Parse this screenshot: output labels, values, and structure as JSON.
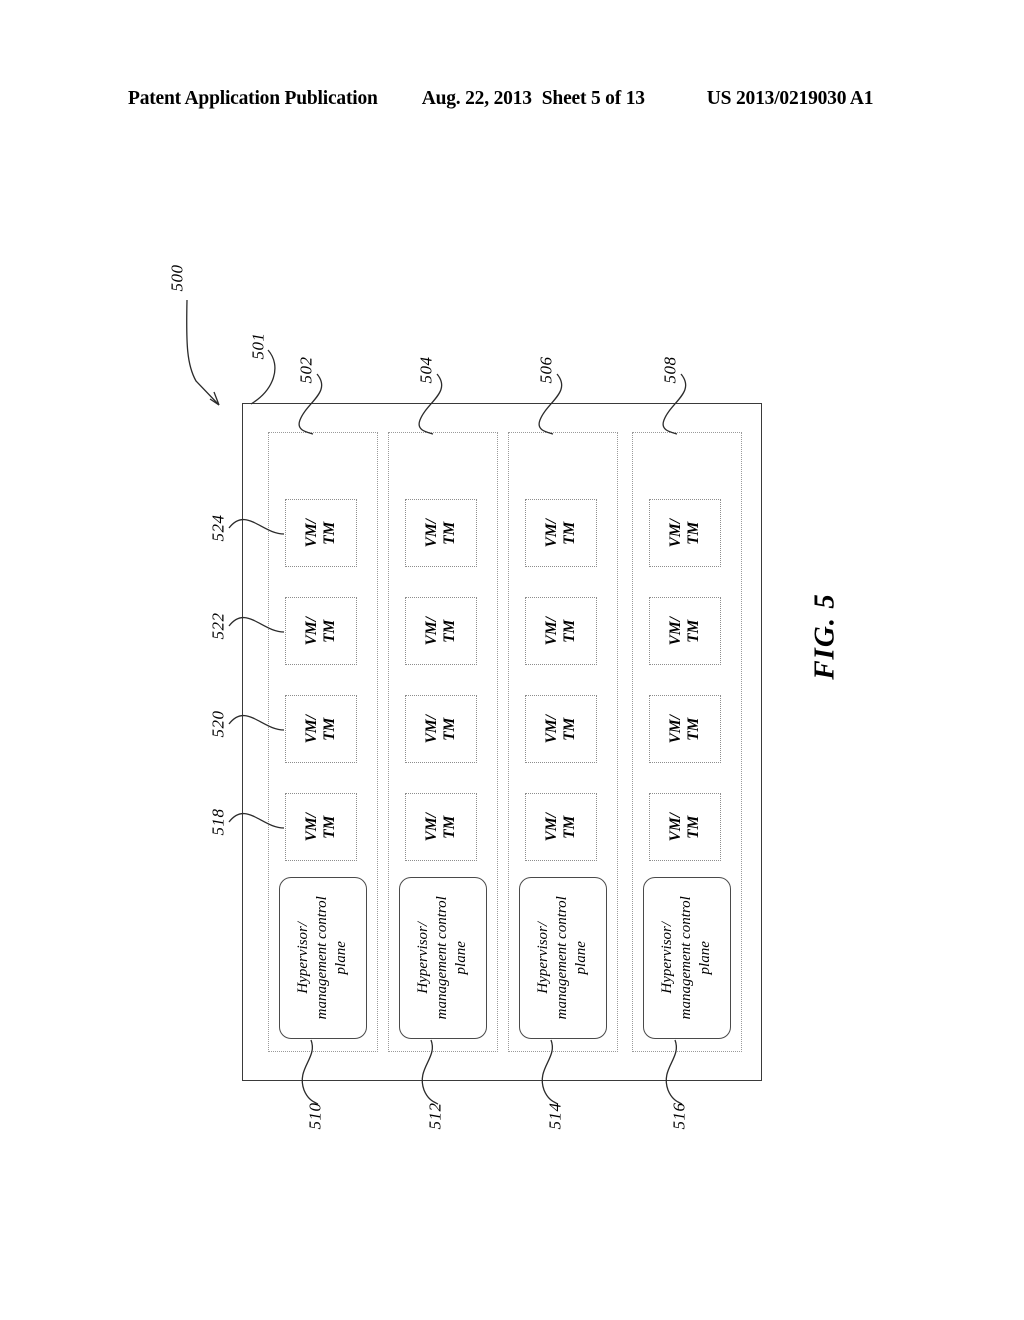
{
  "header": {
    "publication": "Patent Application Publication",
    "date": "Aug. 22, 2013",
    "sheet": "Sheet 5 of 13",
    "patent_number": "US 2013/0219030 A1"
  },
  "figure": {
    "caption": "FIG. 5",
    "system_ref": "500",
    "frame_ref": "501",
    "host_rows": [
      {
        "ref": "502",
        "bottom_ref": "510",
        "hypervisor_label": "Hypervisor/\nmanagement control\nplane",
        "vms": [
          {
            "label": "VM/\nTM",
            "ref": "518"
          },
          {
            "label": "VM/\nTM",
            "ref": "520"
          },
          {
            "label": "VM/\nTM",
            "ref": "522"
          },
          {
            "label": "VM/\nTM",
            "ref": "524"
          }
        ]
      },
      {
        "ref": "504",
        "bottom_ref": "512",
        "hypervisor_label": "Hypervisor/\nmanagement control\nplane",
        "vms": [
          {
            "label": "VM/\nTM",
            "ref": ""
          },
          {
            "label": "VM/\nTM",
            "ref": ""
          },
          {
            "label": "VM/\nTM",
            "ref": ""
          },
          {
            "label": "VM/\nTM",
            "ref": ""
          }
        ]
      },
      {
        "ref": "506",
        "bottom_ref": "514",
        "hypervisor_label": "Hypervisor/\nmanagement control\nplane",
        "vms": [
          {
            "label": "VM/\nTM",
            "ref": ""
          },
          {
            "label": "VM/\nTM",
            "ref": ""
          },
          {
            "label": "VM/\nTM",
            "ref": ""
          },
          {
            "label": "VM/\nTM",
            "ref": ""
          }
        ]
      },
      {
        "ref": "508",
        "bottom_ref": "516",
        "hypervisor_label": "Hypervisor/\nmanagement control\nplane",
        "vms": [
          {
            "label": "VM/\nTM",
            "ref": ""
          },
          {
            "label": "VM/\nTM",
            "ref": ""
          },
          {
            "label": "VM/\nTM",
            "ref": ""
          },
          {
            "label": "VM/\nTM",
            "ref": ""
          }
        ]
      }
    ],
    "vm_row_refs": [
      "518",
      "520",
      "522",
      "524"
    ],
    "bottom_refs": [
      "510",
      "512",
      "514",
      "516"
    ],
    "top_refs": [
      "502",
      "504",
      "506",
      "508"
    ]
  },
  "colors": {
    "ink": "#000000",
    "line": "#2b2b2b",
    "dotted": "#9a9a9a",
    "frame": "#3a3a3a"
  }
}
